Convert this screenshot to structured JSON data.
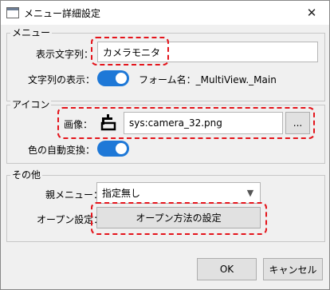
{
  "window": {
    "title": "メニュー詳細設定",
    "close_glyph": "✕"
  },
  "menu_group": {
    "title": "メニュー",
    "display_text_label": "表示文字列：",
    "display_text_value": "カメラモニタ",
    "show_text_label": "文字列の表示：",
    "show_text_on": true,
    "form_name": "フォーム名：_MultiView._Main"
  },
  "icon_group": {
    "title": "アイコン",
    "image_label": "画像：",
    "image_icon": "camera-icon",
    "image_value": "sys:camera_32.png",
    "browse_label": "...",
    "auto_color_label": "色の自動変換：",
    "auto_color_on": true
  },
  "other_group": {
    "title": "その他",
    "parent_menu_label": "親メニュー：",
    "parent_menu_value": "指定無し",
    "open_setting_label": "オープン設定：",
    "open_setting_button": "オープン方法の設定"
  },
  "footer": {
    "ok_label": "OK",
    "cancel_label": "キャンセル"
  },
  "colors": {
    "accent": "#1e78d7",
    "highlight": "#e4141b"
  }
}
